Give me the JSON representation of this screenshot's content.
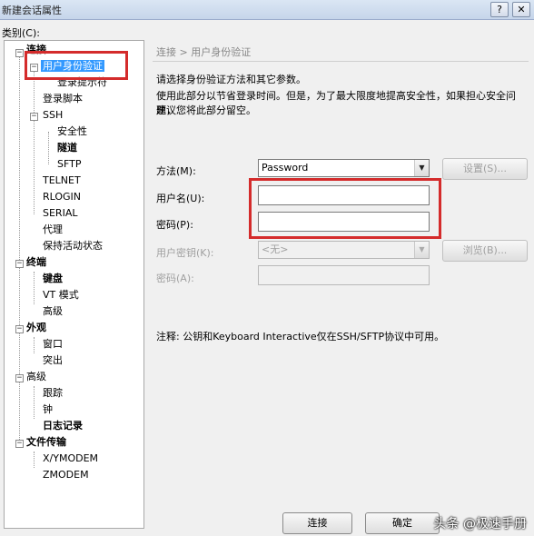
{
  "window": {
    "title": "新建会话属性",
    "help": "?",
    "close": "✕"
  },
  "category_label": "类别(C):",
  "tree": {
    "connection": "连接",
    "user_auth": "用户身份验证",
    "login_prompt": "登录提示符",
    "login_script": "登录脚本",
    "ssh": "SSH",
    "security": "安全性",
    "tunnel": "隧道",
    "sftp": "SFTP",
    "telnet": "TELNET",
    "rlogin": "RLOGIN",
    "serial": "SERIAL",
    "proxy": "代理",
    "keepalive": "保持活动状态",
    "terminal": "终端",
    "keyboard": "键盘",
    "vt_mode": "VT 模式",
    "terminal_advanced": "高级",
    "appearance": "外观",
    "window": "窗口",
    "highlight": "突出",
    "advanced": "高级",
    "trace": "跟踪",
    "bell": "钟",
    "log": "日志记录",
    "file_transfer": "文件传输",
    "xymodem": "X/YMODEM",
    "zmodem": "ZMODEM"
  },
  "panel": {
    "breadcrumb": "连接 > 用户身份验证",
    "desc1": "请选择身份验证方法和其它参数。",
    "desc2": "使用此部分以节省登录时间。但是，为了最大限度地提高安全性，如果担心安全问题，",
    "desc3": "建议您将此部分留空。",
    "method_label": "方法(M):",
    "method_value": "Password",
    "settings_button": "设置(S)...",
    "username_label": "用户名(U):",
    "username_value": "",
    "password_label": "密码(P):",
    "password_value": "",
    "userkey_label": "用户密钥(K):",
    "userkey_value": "<无>",
    "browse_button": "浏览(B)...",
    "passphrase_label": "密码(A):",
    "note": "注释: 公钥和Keyboard Interactive仅在SSH/SFTP协议中可用。"
  },
  "footer": {
    "connect": "连接",
    "ok": "确定"
  },
  "watermark": "头条 @极速手册",
  "colors": {
    "highlight": "#d42b2b",
    "selection": "#3399ff"
  },
  "icons": {
    "expanded": "minus",
    "collapsed": "plus",
    "dropdown": "triangle-down"
  }
}
